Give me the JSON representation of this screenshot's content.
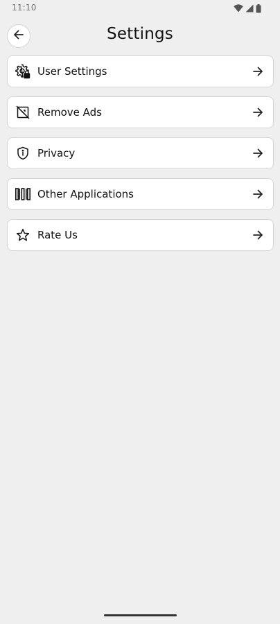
{
  "status_bar": {
    "time": "11:10",
    "icons": [
      "wifi-icon",
      "cellular-signal-icon",
      "battery-icon"
    ]
  },
  "header": {
    "title": "Settings",
    "back_icon": "arrow-left-icon"
  },
  "settings": {
    "items": [
      {
        "label": "User Settings",
        "icon": "user-settings-gear-icon",
        "trailing_icon": "arrow-right-icon"
      },
      {
        "label": "Remove Ads",
        "icon": "remove-ads-icon",
        "trailing_icon": "arrow-right-icon"
      },
      {
        "label": "Privacy",
        "icon": "privacy-shield-icon",
        "trailing_icon": "arrow-right-icon"
      },
      {
        "label": "Other Applications",
        "icon": "other-apps-columns-icon",
        "trailing_icon": "arrow-right-icon"
      },
      {
        "label": "Rate Us",
        "icon": "star-icon",
        "trailing_icon": "arrow-right-icon"
      }
    ]
  },
  "colors": {
    "background": "#efefef",
    "card": "#ffffff",
    "card_border": "#d4d4d4",
    "text": "#111111"
  }
}
